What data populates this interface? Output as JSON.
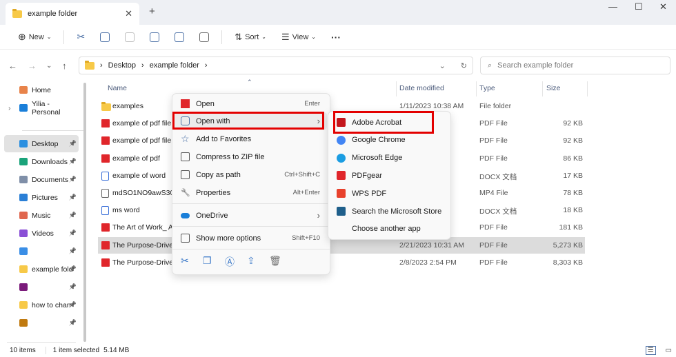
{
  "window": {
    "tab_title": "example folder",
    "close_tab": "✕",
    "new_tab": "+",
    "minimize": "—",
    "maximize": "☐",
    "close": "✕"
  },
  "toolbar": {
    "new": "New",
    "sort": "Sort",
    "view": "View",
    "more": "···"
  },
  "address": {
    "crumbs": [
      "Desktop",
      "example folder"
    ],
    "search_placeholder": "Search example folder"
  },
  "sidebar": {
    "items": [
      {
        "label": "Home",
        "color": "#e8834a"
      },
      {
        "label": "Yilia - Personal",
        "color": "#1a7fd9"
      },
      {
        "label": "Desktop",
        "color": "#2b8fe0",
        "pinned": true,
        "selected": true
      },
      {
        "label": "Downloads",
        "color": "#1aa37a",
        "pinned": true
      },
      {
        "label": "Documents",
        "color": "#7f8fa8",
        "pinned": true
      },
      {
        "label": "Pictures",
        "color": "#2a7fd6",
        "pinned": true
      },
      {
        "label": "Music",
        "color": "#e0674f",
        "pinned": true
      },
      {
        "label": "Videos",
        "color": "#8a4fd6",
        "pinned": true
      },
      {
        "label": "",
        "color": "#3a8ee6",
        "pinned": true
      },
      {
        "label": "example fold",
        "color": "#f7c948",
        "pinned": true
      },
      {
        "label": "",
        "color": "#7a1a7a",
        "pinned": true
      },
      {
        "label": "how to chan",
        "color": "#f7c948",
        "pinned": true
      },
      {
        "label": "",
        "color": "#c07a10",
        "pinned": true
      }
    ]
  },
  "columns": {
    "name": "Name",
    "date": "Date modified",
    "type": "Type",
    "size": "Size"
  },
  "files": [
    {
      "name": "examples",
      "date": "1/11/2023 10:38 AM",
      "type": "File folder",
      "size": "",
      "icon": "folder"
    },
    {
      "name": "example of pdf file h",
      "date": "",
      "type": "PDF File",
      "size": "92 KB",
      "icon": "pdf"
    },
    {
      "name": "example of pdf file",
      "date": "",
      "type": "PDF File",
      "size": "92 KB",
      "icon": "pdf"
    },
    {
      "name": "example of pdf",
      "date": "",
      "type": "PDF File",
      "size": "86 KB",
      "icon": "pdf"
    },
    {
      "name": "example of word",
      "date": "",
      "type": "DOCX 文档",
      "size": "17 KB",
      "icon": "docx"
    },
    {
      "name": "mdSO1NO9awS309v",
      "date": "",
      "type": "MP4 File",
      "size": "78 KB",
      "icon": "mp4"
    },
    {
      "name": "ms word",
      "date": "",
      "type": "DOCX 文档",
      "size": "18 KB",
      "icon": "docx"
    },
    {
      "name": "The Art of Work_ A P",
      "date": "",
      "type": "PDF File",
      "size": "181 KB",
      "icon": "pdf"
    },
    {
      "name": "The Purpose-Driven",
      "date": "2/21/2023 10:31 AM",
      "type": "PDF File",
      "size": "5,273 KB",
      "icon": "pdf",
      "selected": true
    },
    {
      "name": "The Purpose-Driven",
      "date": "2/8/2023 2:54 PM",
      "type": "PDF File",
      "size": "8,303 KB",
      "icon": "pdf"
    }
  ],
  "context_menu": {
    "items": [
      {
        "label": "Open",
        "shortcut": "Enter",
        "icon": "pdfgear-icon"
      },
      {
        "label": "Open with",
        "shortcut": "",
        "icon": "open-with-icon",
        "submenu": true,
        "highlighted": true
      },
      {
        "label": "Add to Favorites",
        "shortcut": "",
        "icon": "star-icon"
      },
      {
        "label": "Compress to ZIP file",
        "shortcut": "",
        "icon": "zip-icon"
      },
      {
        "label": "Copy as path",
        "shortcut": "Ctrl+Shift+C",
        "icon": "path-icon"
      },
      {
        "label": "Properties",
        "shortcut": "Alt+Enter",
        "icon": "wrench-icon"
      },
      {
        "label": "OneDrive",
        "shortcut": "",
        "icon": "onedrive-icon",
        "submenu": true
      },
      {
        "label": "Show more options",
        "shortcut": "Shift+F10",
        "icon": "more-options-icon"
      }
    ],
    "bottom_icons": [
      "cut",
      "copy",
      "rename",
      "share",
      "delete"
    ]
  },
  "open_with": {
    "items": [
      {
        "label": "Adobe Acrobat",
        "color": "#c4161c",
        "highlighted": true
      },
      {
        "label": "Google Chrome",
        "color": "#4285f4"
      },
      {
        "label": "Microsoft Edge",
        "color": "#1b9de2"
      },
      {
        "label": "PDFgear",
        "color": "#e0262b"
      },
      {
        "label": "WPS PDF",
        "color": "#e8412c"
      },
      {
        "label": "Search the Microsoft Store",
        "color": "#1f5f8b"
      },
      {
        "label": "Choose another app",
        "color": ""
      }
    ]
  },
  "status": {
    "count": "10 items",
    "selected": "1 item selected",
    "size": "5.14 MB"
  },
  "accent": "#e30000"
}
